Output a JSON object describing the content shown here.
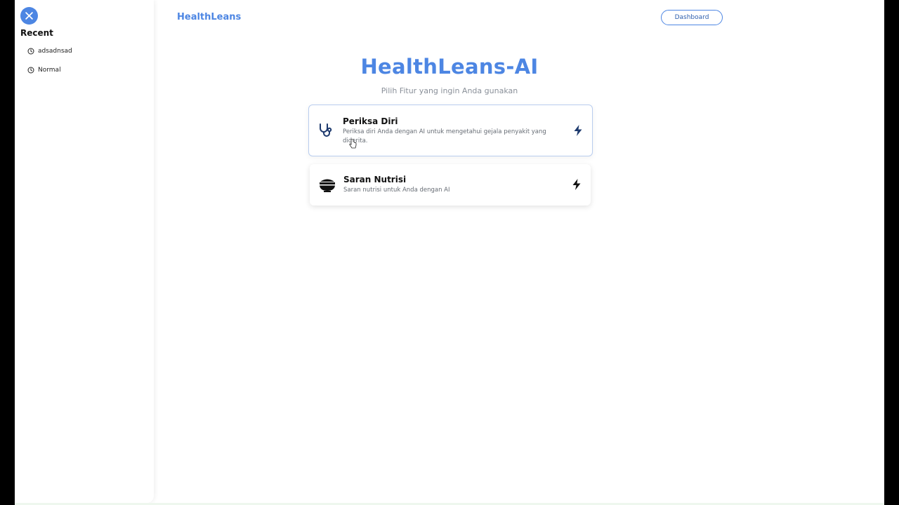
{
  "sidebar": {
    "close_icon": "close-icon",
    "recent_title": "Recent",
    "items": [
      {
        "label": "adsadnsad",
        "icon": "clock-icon"
      },
      {
        "label": "Normal",
        "icon": "clock-icon"
      }
    ]
  },
  "header": {
    "brand": "HealthLeans",
    "dashboard_label": "Dashboard"
  },
  "main": {
    "title": "HealthLeans-AI",
    "subtitle": "Pilih Fitur yang ingin Anda gunakan",
    "cards": [
      {
        "title": "Periksa Diri",
        "description": "Periksa diri Anda dengan AI untuk mengetahui gejala penyakit yang diderita.",
        "icon": "stethoscope-icon",
        "action_icon": "bolt-icon"
      },
      {
        "title": "Saran Nutrisi",
        "description": "Saran nutrisi untuk Anda dengan AI",
        "icon": "food-bowl-icon",
        "action_icon": "bolt-icon"
      }
    ]
  },
  "colors": {
    "accent": "#4d86e3",
    "card_icon_dark": "#1e3a6e",
    "subtitle": "#8a9099"
  }
}
